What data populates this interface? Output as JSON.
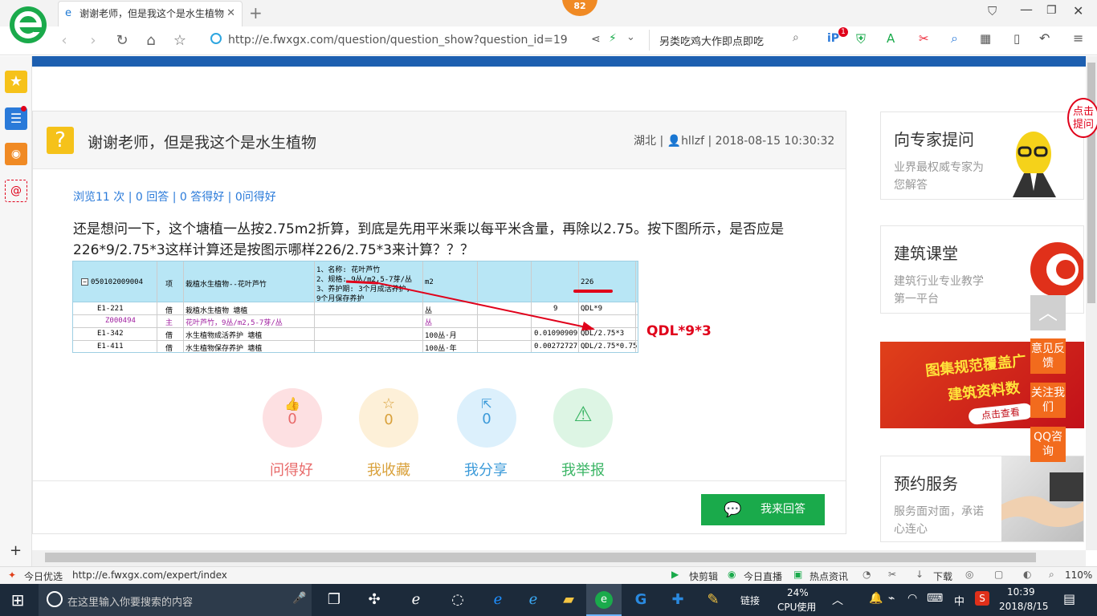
{
  "browser": {
    "tab_title": "谢谢老师，但是我这个是水生植物",
    "badge": "82",
    "address_url": "http://e.fwxgx.com/question/question_show?question_id=19",
    "search_text": "另类吃鸡大作即点即吃",
    "notify_count": "1"
  },
  "question": {
    "title": "谢谢老师，但是我这个是水生植物",
    "meta_region": "湖北",
    "meta_user": "hllzf",
    "meta_time": "2018-08-15 10:30:32",
    "stats": "浏览11 次 | 0 回答 | 0 答得好 | 0问得好",
    "body": "还是想问一下，这个塘植一丛按2.75m2折算，到底是先用平米乘以每平米含量，再除以2.75。按下图所示，是否应是226*9/2.75*3这样计算还是按图示哪样226/2.75*3来计算？？？",
    "annotation": "QDL*9*3"
  },
  "table": {
    "head_code": "050102009004",
    "head_type": "项",
    "head_name": "栽植水生植物--花叶芦竹",
    "head_desc": [
      "1、名称: 花叶芦竹",
      "2、规格: 9丛/m2,5-7芽/丛",
      "3、养护期: 3个月成活养护,",
      "9个月保存养护"
    ],
    "head_unit": "m2",
    "head_qty": "226",
    "rows": [
      {
        "code": "E1-221",
        "type": "借",
        "name": "栽植水生植物 塘植",
        "unit": "丛",
        "coef": "9",
        "expr": "QDL*9"
      },
      {
        "code": "Z000494",
        "type": "主",
        "name": "花叶芦竹，9丛/m2,5-7芽/丛",
        "unit": "丛",
        "coef": "",
        "expr": ""
      },
      {
        "code": "E1-342",
        "type": "借",
        "name": "水生植物成活养护 塘植",
        "unit": "100丛·月",
        "coef": "0.01090909",
        "expr": "QDL/2.75*3"
      },
      {
        "code": "E1-411",
        "type": "借",
        "name": "水生植物保存养护 塘植",
        "unit": "100丛·年",
        "coef": "0.00272727",
        "expr": "QDL/2.75*0.75"
      }
    ]
  },
  "actions": [
    {
      "name": "ask-good",
      "count": "0",
      "label": "问得好",
      "color": "#e86a6a",
      "bg": "#fde0e2"
    },
    {
      "name": "favorite",
      "count": "0",
      "label": "我收藏",
      "color": "#d9a13b",
      "bg": "#fdf0d8"
    },
    {
      "name": "share",
      "count": "0",
      "label": "我分享",
      "color": "#3b9ad9",
      "bg": "#dcf0fc"
    },
    {
      "name": "report",
      "count": "0",
      "label": "我举报",
      "color": "#3bb565",
      "bg": "#ddf5e4"
    }
  ],
  "answer_button": "我来回答",
  "right": {
    "expert_title": "向专家提问",
    "expert_sub": "业界最权威专家为您解答",
    "expert_bubble": "点击提问",
    "class_title": "建筑课堂",
    "class_sub": "建筑行业专业教学第一平台",
    "banner_line1": "图集规范覆盖广",
    "banner_line2": "建筑资料数",
    "banner_btn": "点击查看",
    "service_title": "预约服务",
    "service_sub": "服务面对面，承诺心连心"
  },
  "float": [
    "意见反馈",
    "关注我们",
    "QQ咨询"
  ],
  "status": {
    "left": "今日优选",
    "url": "http://e.fwxgx.com/expert/index",
    "items": [
      "快剪辑",
      "今日直播",
      "热点资讯",
      "下载"
    ],
    "zoom": "110%"
  },
  "taskbar": {
    "search": "在这里输入你要搜索的内容",
    "link": "链接",
    "cpu_pct": "24%",
    "cpu_label": "CPU使用",
    "ime": "中",
    "time": "10:39",
    "date": "2018/8/15"
  },
  "colors": {
    "green": "#1aaa4b",
    "blue": "#1d5fb0",
    "red": "#e0001a",
    "orange": "#f26b1d"
  }
}
